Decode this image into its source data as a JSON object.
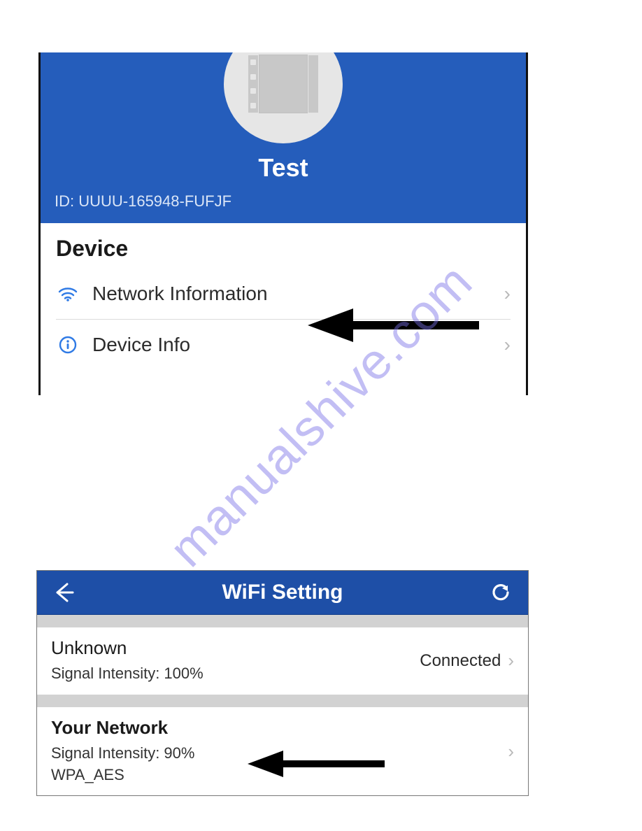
{
  "watermark": "manualshive.com",
  "screen1": {
    "title": "Test",
    "device_id": "ID: UUUU-165948-FUFJF",
    "section_label": "Device",
    "rows": {
      "network_info": {
        "label": "Network Information"
      },
      "device_info": {
        "label": "Device Info"
      }
    }
  },
  "screen2": {
    "title": "WiFi Setting",
    "networks": [
      {
        "name": "Unknown",
        "signal_label": "Signal Intensity: 100%",
        "status": "Connected"
      },
      {
        "name": "Your Network",
        "signal_label": "Signal Intensity: 90%",
        "security": "WPA_AES"
      }
    ]
  }
}
